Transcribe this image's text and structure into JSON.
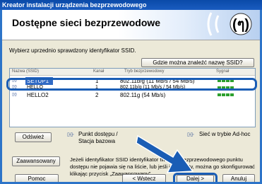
{
  "window": {
    "title": "Kreator instalacji urządzenia bezprzewodowego"
  },
  "banner": {
    "title": "Dostępne sieci bezprzewodowe",
    "logo_icon": "wireless-icon"
  },
  "instruction": "Wybierz uprzednio sprawdzony identyfikator SSID.",
  "buttons": {
    "ssid_help": "Gdzie można znaleźć nazwę SSID?",
    "refresh": "Odśwież",
    "advanced": "Zaawansowany",
    "help": "Pomoc",
    "back": "< Wstecz",
    "next": "Dalej >",
    "cancel": "Anuluj"
  },
  "table": {
    "headers": [
      "Nazwa (SSID)",
      "Kanał",
      "Tryb bezprzewodowy",
      "Sygnał"
    ],
    "rows": [
      {
        "icon": "access-point-icon",
        "ssid": "SETUP1",
        "channel": "1",
        "mode": "802.11b/g (11 Mb/s / 54 Mb/s)",
        "signal": 4,
        "selected": true
      },
      {
        "icon": "access-point-icon",
        "ssid": "HELLO",
        "channel": "1",
        "mode": "802.11b/g (11 Mb/s / 54 Mb/s)",
        "signal": 4,
        "selected": false
      },
      {
        "icon": "access-point-icon",
        "ssid": "HELLO2",
        "channel": "2",
        "mode": "802.11g (54 Mb/s)",
        "signal": 4,
        "selected": false
      }
    ]
  },
  "legend": {
    "access_point": "Punkt dostępu / Stacja bazowa",
    "adhoc": "Sieć w trybie Ad-hoc"
  },
  "description": "Jeżeli identyfikator SSID identyfikator twojego Bezprzewodowego punktu dostępu nie pojawia się na liście, lub jeśli jest ukryty, można go skonfigurować klikając przycisk „Zaawansowany”.",
  "colors": {
    "accent": "#1a5db5",
    "selection": "#316ac5",
    "signal": "#2da02d"
  }
}
